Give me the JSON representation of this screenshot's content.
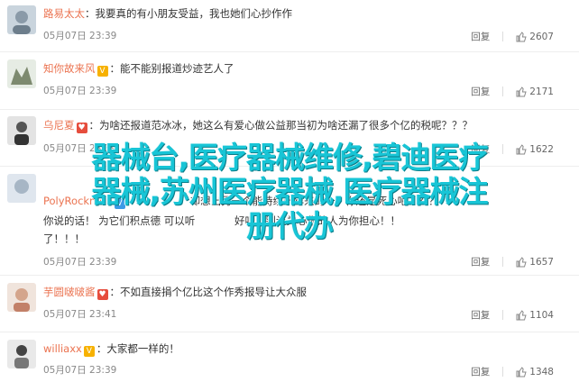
{
  "colors": {
    "username": "#eb7350",
    "overlay": "#18c5d6"
  },
  "comments": [
    {
      "username": "路易太太",
      "badges": [],
      "text": "我要真的有小朋友受益，我也她们心抄作作",
      "time": "05月07日 23:39",
      "report": "回复",
      "likes": "2607"
    },
    {
      "username": "知你故来风",
      "badges": [
        "gold"
      ],
      "text": "能不能别报道炒迹艺人了",
      "time": "05月07日 23:39",
      "report": "回复",
      "likes": "2171"
    },
    {
      "username": "乌尼夏",
      "badges": [
        "red"
      ],
      "text": "为啥还报道范冰冰，她这么有爱心做公益那当初为啥还漏了很多个亿的税呢？？？",
      "time": "05月07日 23:39",
      "report": "回复",
      "likes": "1622"
    },
    {
      "username": "",
      "badges": [],
      "text": "",
      "time": "",
      "report": "回复",
      "likes": ""
    },
    {
      "username": "PolyRockmen",
      "badges": [
        "blue"
      ],
      "text": "",
      "time": "",
      "report": "",
      "likes": ""
    },
    {
      "username": "",
      "badges": [],
      "text": "了！！！",
      "time": "05月07日 23:39",
      "report": "回复",
      "likes": "1657"
    },
    {
      "username": "芋圆啵啵酱",
      "badges": [
        "red"
      ],
      "text": "不如直接捐个亿比这个作秀报导让大众服",
      "time": "05月07日 23:41",
      "report": "回复",
      "likes": "1104"
    },
    {
      "username": "williaxx",
      "badges": [
        "gold"
      ],
      "text": "大家都一样的！",
      "time": "05月07日 23:39",
      "report": "回复",
      "likes": "1348"
    }
  ],
  "overlay": {
    "line1": "器械台,医疗器械维修,碧迪医疗",
    "line2": "器械,苏州医疗器械,医疗器械注",
    "line3": "册代办"
  },
  "partial_text": {
    "row4_text": "为它们积点德 可以听",
    "row4_text_end": "好吧，别让关心你的人为你担心！！",
    "row4_right": "却想出另一个能持续十年来的一，你还是死心吧？？？",
    "row4_mid": "你说的话！"
  }
}
